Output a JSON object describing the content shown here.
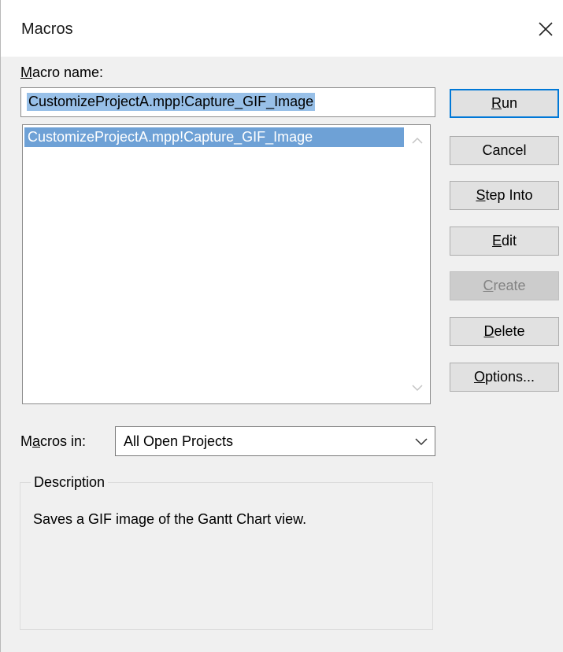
{
  "window": {
    "title": "Macros",
    "close_icon": "close-icon"
  },
  "macro_name": {
    "label_accel": "M",
    "label_rest": "acro name:",
    "value": "CustomizeProjectA.mpp!Capture_GIF_Image"
  },
  "macro_list": {
    "items": [
      "CustomizeProjectA.mpp!Capture_GIF_Image"
    ],
    "selected_index": 0,
    "scroll_up_icon": "chevron-up-icon",
    "scroll_down_icon": "chevron-down-icon"
  },
  "buttons": {
    "run": {
      "accel": "R",
      "rest": "un"
    },
    "cancel": {
      "label": "Cancel"
    },
    "step_into": {
      "accel": "S",
      "rest": "tep Into"
    },
    "edit": {
      "accel": "E",
      "rest": "dit"
    },
    "create": {
      "accel": "C",
      "rest": "reate",
      "enabled": false
    },
    "delete": {
      "accel": "D",
      "rest": "elete"
    },
    "options": {
      "accel": "O",
      "rest": "ptions..."
    }
  },
  "macros_in": {
    "label_pre": "M",
    "label_accel": "a",
    "label_post": "cros in:",
    "selected": "All Open Projects"
  },
  "description": {
    "legend": "Description",
    "text": "Saves a GIF image of the Gantt Chart view."
  },
  "colors": {
    "selection_highlight": "#6ea1d6",
    "default_button_border": "#0078d7",
    "disabled_text": "#838383"
  }
}
